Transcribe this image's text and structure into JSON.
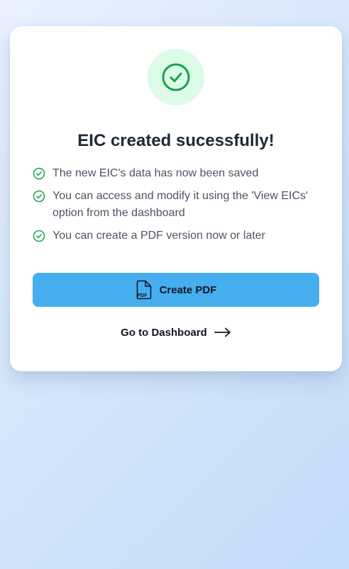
{
  "card": {
    "title": "EIC created sucessfully!",
    "status_icon": "check-circle-icon",
    "points": [
      "The new EIC's data has now been saved",
      "You can access and modify it using the 'View EICs' option from the dashboard",
      "You can create a PDF version now or later"
    ],
    "point_icon": "check-circle-icon",
    "create_pdf": {
      "label": "Create PDF",
      "icon": "pdf-file-icon",
      "icon_text": "PDF"
    },
    "dashboard_link": {
      "label": "Go to Dashboard",
      "icon": "arrow-right-icon"
    }
  },
  "colors": {
    "success_green": "#16a34a",
    "success_bg": "#dcfce7",
    "button_blue": "#46aeee",
    "title_text": "#1f2937",
    "body_text": "#4b5563"
  }
}
